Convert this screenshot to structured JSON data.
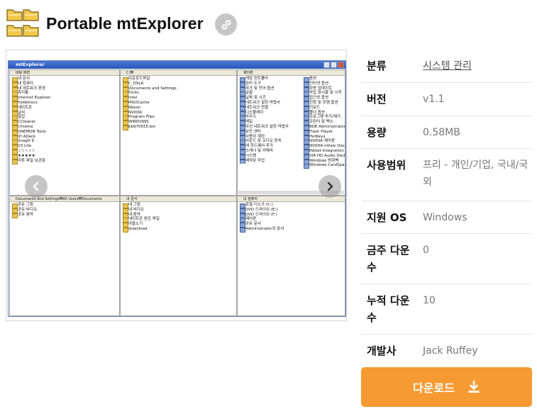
{
  "header": {
    "title": "Portable mtExplorer",
    "app_icon": "folder-grid-icon",
    "link_icon": "link-icon"
  },
  "screenshot": {
    "window_title": "mtExplorer",
    "panes": [
      {
        "path": "바탕 화면",
        "items": [
          "내 문서",
          "내 컴퓨터",
          "내 네트워크 환경",
          "휴지통",
          "Internet Explorer",
          "Folderlocs",
          "네이트온",
          "날씨",
          "알집",
          "CCleaner",
          "Chrome",
          "DAEMON Tools",
          "ID ADeck",
          "SnagIt 9",
          "V3 Lite",
          "☆☆☆☆☆",
          "★★★★★",
          "미투 파일 보관함"
        ]
      },
      {
        "path": "C:₩",
        "items": [
          "다운로드파일",
          "C_DSLA",
          "Documents and Settings",
          "Fonts",
          "Intel",
          "MSOCache",
          "Nexon",
          "NVIDIA",
          "Program Files",
          "WINDOWS",
          "bb970555.bin"
        ]
      },
      {
        "path": "제어판",
        "items_left": [
          "게임 컨트롤러",
          "관리 도구",
          "국가 및 언어 옵션",
          "글꼴",
          "날짜 및 시간",
          "네트워크 설정 마법사",
          "네트워크 연결",
          "디스플레이",
          "마우스",
          "메일",
          "무선 네트워크 설정 마법사",
          "보안 센터",
          "사용자 계정",
          "사운드 및 오디오 장치",
          "새 하드웨어 추가",
          "스캐너 및 카메라",
          "시스템",
          "예약된 작업"
        ],
        "items_right": [
          "음성",
          "인터넷 옵션",
          "자동 업데이트",
          "작업 표시줄 및 시작",
          "접근성 옵션",
          "전원 및 모뎀 옵션",
          "키보드",
          "폴더 옵션",
          "프로그램 추가/제거",
          "프린터 및 팩스",
          "BDE Administrator",
          "Flash Player",
          "HotKeys",
          "NVIDIA 제어판",
          "NVIDIA nView Desktop",
          "ReGet Integration",
          "VIA HD Audio Deck",
          "Windows 방화벽",
          "Windows CardSpace"
        ]
      },
      {
        "path": "Documents and Settings₩All Users₩Documents",
        "items": [
          "공유 그림",
          "공유 비디오",
          "공유 음악"
        ]
      },
      {
        "path": "내 문서",
        "items": [
          "내 그림",
          "내 비디오",
          "내 음악",
          "네이트온 받은 파일",
          "아들노기",
          "download"
        ]
      },
      {
        "path": "내 컴퓨터",
        "items": [
          "로컬 디스크 (C:)",
          "DVD 드라이브 (E:)",
          "DVD 드라이브 (F:)",
          "제어판",
          "공유 문서",
          "Administrator의 문서"
        ]
      }
    ]
  },
  "spec": [
    {
      "key": "분류",
      "value": "시스템 관리",
      "link": true
    },
    {
      "key": "버전",
      "value": "v1.1"
    },
    {
      "key": "용량",
      "value": "0.58MB"
    },
    {
      "key": "사용범위",
      "value": "프리 - 개인/기업, 국내/국외"
    },
    {
      "key": "지원 OS",
      "value": "Windows"
    },
    {
      "key": "금주 다운수",
      "value": "0"
    },
    {
      "key": "누적 다운수",
      "value": "10"
    },
    {
      "key": "개발사",
      "value": "Jack Ruffey"
    }
  ],
  "download": {
    "label": "다운로드",
    "icon": "download-icon"
  },
  "colors": {
    "accent": "#f79a32",
    "link_button": "#c6c6c6"
  }
}
